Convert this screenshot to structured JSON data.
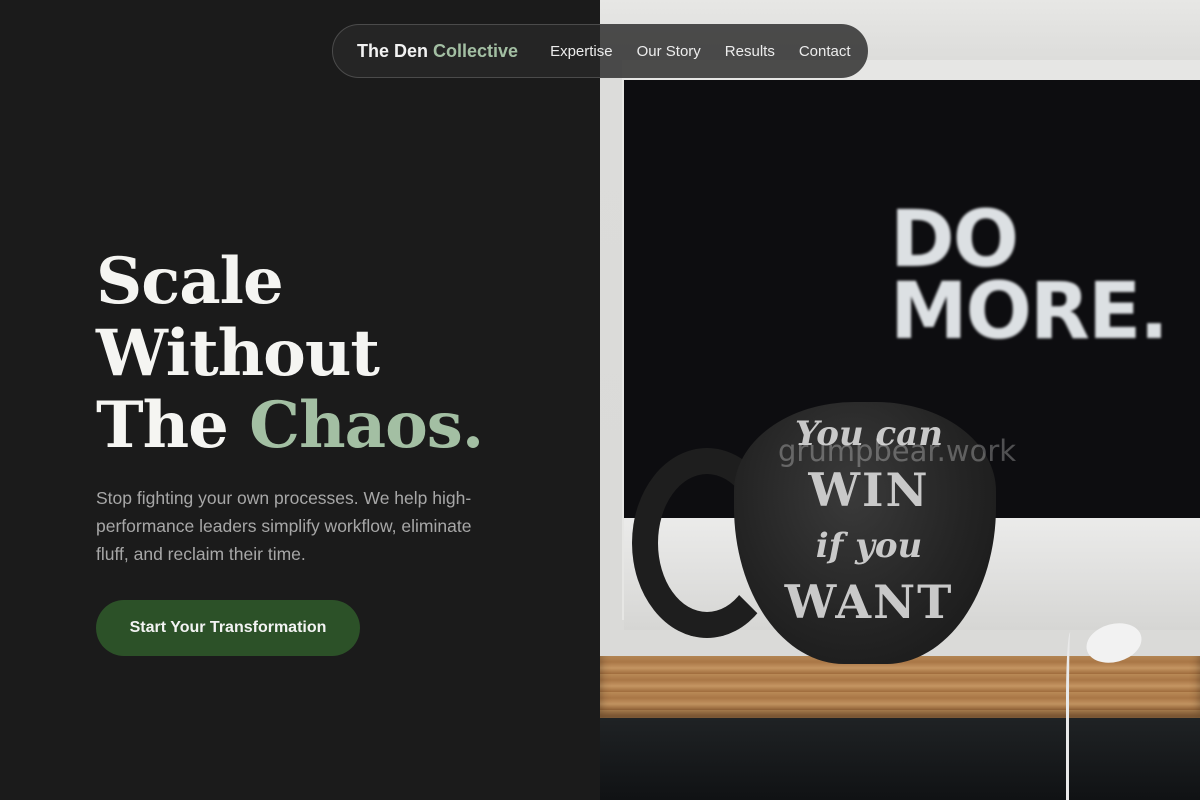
{
  "nav": {
    "brand_primary": "The Den",
    "brand_accent": "Collective",
    "links": [
      "Expertise",
      "Our Story",
      "Results",
      "Contact"
    ]
  },
  "hero": {
    "headline_line1": "Scale",
    "headline_line2": "Without",
    "headline_line3_plain": "The",
    "headline_line3_accent": "Chaos.",
    "subtext": "Stop fighting your own processes. We help high-performance leaders simplify workflow, eliminate fluff, and reclaim their time.",
    "cta_label": "Start Your Transformation"
  },
  "image": {
    "monitor_text": [
      "DO",
      "MORE."
    ],
    "mug_text": [
      "You can",
      "WIN",
      "if you",
      "WANT"
    ],
    "watermark": "grumpbear.work"
  },
  "colors": {
    "background": "#1b1b1b",
    "accent_green": "#a3bfa3",
    "cta_green": "#2c5128",
    "text_light": "#f5f5f2",
    "text_muted": "#a7a7a7"
  }
}
